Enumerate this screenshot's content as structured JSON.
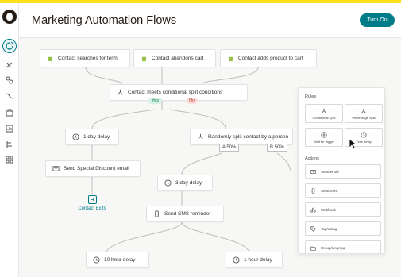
{
  "header": {
    "title": "Marketing Automation Flows",
    "turn_on_label": "Turn On"
  },
  "nodes": {
    "trigger1": "Contact searches for term",
    "trigger2": "Contact abandons cart",
    "trigger3": "Contact adds product to cart",
    "condition": "Contact meets conditional split conditions",
    "yes": "Yes",
    "no": "No",
    "delay1": "1 day delay",
    "random_split": "Randomly split contact by a percen",
    "split_a": "A 50%",
    "split_b": "B 50%",
    "email": "Send Special Discount email",
    "contact_exits": "Contact Exits",
    "delay3": "3 day delay",
    "sms": "Send SMS reminder",
    "delay10h": "10 hour delay",
    "delay1h": "1 hour delay"
  },
  "panel": {
    "rules_label": "Rules",
    "rules": [
      "Conditional Split",
      "Percentage Split",
      "Wait for trigger",
      "Time delay"
    ],
    "actions_label": "Actions",
    "actions": [
      "Send email",
      "Send SMS",
      "Webhook",
      "Tag/Untag",
      "Group/Ungroup"
    ]
  },
  "colors": {
    "accent": "#007c89",
    "brand_yellow": "#ffe01b",
    "yes_bg": "#d3f1e4",
    "no_bg": "#fde0dd"
  }
}
